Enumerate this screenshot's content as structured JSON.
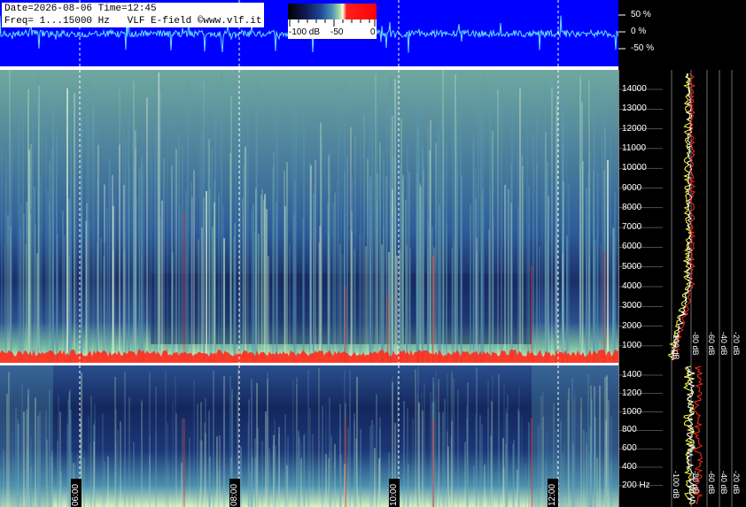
{
  "info": {
    "line1": "Date=2026-08-06 Time=12:45",
    "line2": "Freq= 1...15000 Hz   VLF E-field ©www.vlf.it"
  },
  "colorbar": {
    "labels": [
      "-100 dB",
      "-50",
      "0"
    ]
  },
  "waveform_axis": {
    "ticks": [
      "50 %",
      "0 %",
      "-50 %"
    ]
  },
  "upper_freq_ticks": [
    "14000",
    "13000",
    "12000",
    "11000",
    "10000",
    "9000",
    "8000",
    "7000",
    "6000",
    "5000",
    "4000",
    "3000",
    "2000",
    "1000"
  ],
  "lower_freq_ticks": [
    "1400",
    "1200",
    "1000",
    "800",
    "600",
    "400",
    "200 Hz"
  ],
  "time_ticks": [
    "06:00",
    "08:00",
    "10:00",
    "12:00"
  ],
  "db_ticks_upper": [
    "-100 dB",
    "-80 dB",
    "-60 dB",
    "-40 dB",
    "-20 dB"
  ],
  "db_ticks_lower": [
    "-100 dB",
    "-80 dB",
    "-60 dB",
    "-40 dB",
    "-20 dB"
  ],
  "colors": {
    "wave_bg": "#0000ff",
    "wave_trace": "#66e0ff",
    "spectrum_bright": "#c8f0b0",
    "spectrum_dark": "#1a2f6a",
    "line_red": "#ff2a1a"
  },
  "chart_data": {
    "type": "heatmap",
    "title": "VLF E-field spectrogram",
    "x_axis": {
      "kind": "time",
      "ticks": [
        "06:00",
        "08:00",
        "10:00",
        "12:00"
      ]
    },
    "y_axis_upper": {
      "unit": "Hz",
      "range": [
        0,
        15000
      ],
      "ticks": [
        1000,
        2000,
        3000,
        4000,
        5000,
        6000,
        7000,
        8000,
        9000,
        10000,
        11000,
        12000,
        13000,
        14000
      ]
    },
    "y_axis_lower": {
      "unit": "Hz",
      "range": [
        0,
        1500
      ],
      "ticks": [
        200,
        400,
        600,
        800,
        1000,
        1200,
        1400
      ]
    },
    "color_scale_db": [
      -100,
      0
    ],
    "profile_x_axis_db": [
      -100,
      -80,
      -60,
      -40,
      -20
    ]
  }
}
